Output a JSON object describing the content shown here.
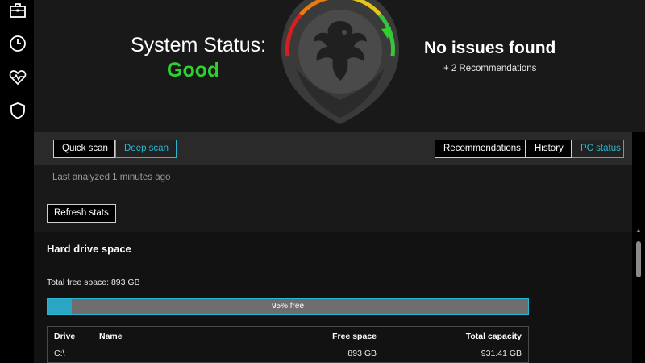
{
  "sidebar": {
    "icons": [
      "briefcase-icon",
      "clock-icon",
      "heartbeat-icon",
      "shield-icon"
    ]
  },
  "header": {
    "status_label": "System Status:",
    "status_value": "Good",
    "issues_title": "No issues found",
    "issues_sub": "+ 2 Recommendations"
  },
  "toolbar": {
    "quick_scan": "Quick scan",
    "deep_scan": "Deep scan",
    "recommendations": "Recommendations",
    "history": "History",
    "pc_status": "PC status"
  },
  "content": {
    "last_analyzed": "Last analyzed 1 minutes ago",
    "refresh": "Refresh stats"
  },
  "drive_space": {
    "title": "Hard drive space",
    "total_free": "Total free space: 893 GB",
    "bar_label": "95% free",
    "free_fraction": 0.05,
    "columns": {
      "drive": "Drive",
      "name": "Name",
      "free": "Free space",
      "capacity": "Total capacity"
    },
    "rows": [
      {
        "drive": "C:\\",
        "name": "",
        "free": "893 GB",
        "capacity": "931.41 GB"
      }
    ]
  },
  "colors": {
    "accent": "#29b6d3",
    "good": "#2ed12e",
    "gauge_red": "#d42020",
    "gauge_orange": "#e87a10",
    "gauge_yellow": "#e6c418",
    "gauge_green": "#3ac43a"
  }
}
